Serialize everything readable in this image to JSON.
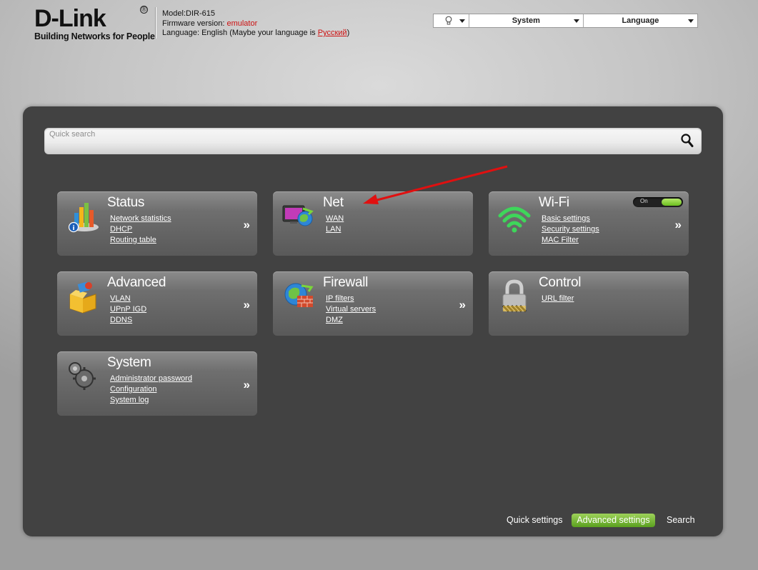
{
  "header": {
    "logo_text": "D-Link",
    "logo_reg": "®",
    "logo_tagline": "Building Networks for People",
    "model_label": "Model:",
    "model_value": "DIR-615",
    "firmware_label": "Firmware version:",
    "firmware_value": "emulator",
    "language_label": "Language:",
    "language_value": "English",
    "language_note_prefix": "(Maybe your language is",
    "language_suggest": "Русский",
    "language_note_suffix": ")"
  },
  "topbar": {
    "hint_icon": "lightbulb-icon",
    "system_label": "System",
    "language_label": "Language"
  },
  "search": {
    "placeholder": "Quick search",
    "icon": "magnifier-icon"
  },
  "tiles": {
    "status": {
      "title": "Status",
      "icon": "bar-chart-icon",
      "links": [
        "Network statistics",
        "DHCP",
        "Routing table"
      ],
      "arrow": "»"
    },
    "net": {
      "title": "Net",
      "icon": "monitor-globe-icon",
      "links": [
        "WAN",
        "LAN"
      ]
    },
    "wifi": {
      "title": "Wi-Fi",
      "icon": "wifi-icon",
      "toggle_label": "On",
      "links": [
        "Basic settings",
        "Security settings",
        "MAC Filter"
      ],
      "arrow": "»"
    },
    "advanced": {
      "title": "Advanced",
      "icon": "box-tools-icon",
      "links": [
        "VLAN",
        "UPnP IGD",
        "DDNS"
      ],
      "arrow": "»"
    },
    "firewall": {
      "title": "Firewall",
      "icon": "globe-brick-wall-icon",
      "links": [
        "IP filters",
        "Virtual servers",
        "DMZ"
      ],
      "arrow": "»"
    },
    "control": {
      "title": "Control",
      "icon": "padlock-icon",
      "links": [
        "URL filter"
      ]
    },
    "system": {
      "title": "System",
      "icon": "gears-icon",
      "links": [
        "Administrator password",
        "Configuration",
        "System log"
      ],
      "arrow": "»"
    }
  },
  "footer": {
    "quick_settings": "Quick settings",
    "advanced_settings": "Advanced settings",
    "search": "Search"
  },
  "colors": {
    "panel": "#424242",
    "accent_green": "#6bbf1e",
    "firmware_red": "#cc1111",
    "annotation_arrow": "#e01010"
  }
}
